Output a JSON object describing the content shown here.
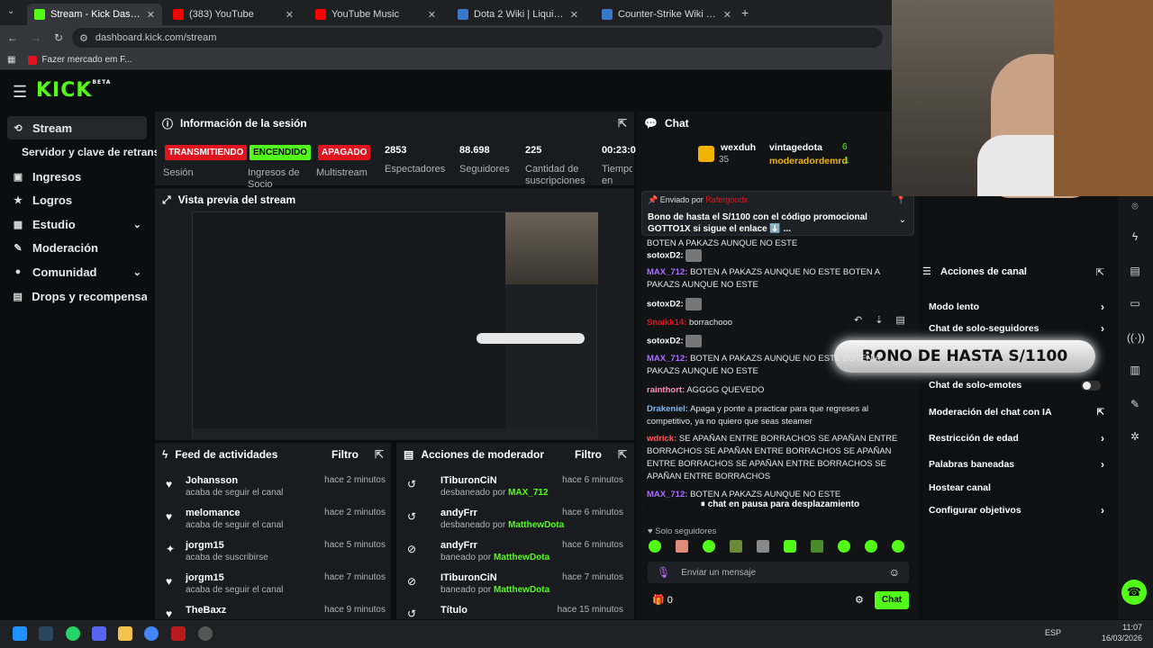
{
  "tabs": [
    {
      "title": "Stream - Kick Dashboard",
      "active": true,
      "color": "#53fc18"
    },
    {
      "title": "(383) YouTube",
      "active": false,
      "color": "#ff0000"
    },
    {
      "title": "YouTube Music",
      "active": false,
      "color": "#ff0000"
    },
    {
      "title": "Dota 2 Wiki | Liquipedia",
      "active": false,
      "color": "#3c76c8"
    },
    {
      "title": "Counter-Strike Wiki | CS2 | Liqu",
      "active": false,
      "color": "#3c76c8"
    }
  ],
  "address": "dashboard.kick.com/stream",
  "bookmark": "Fazer mercado em F...",
  "logo": "KICK",
  "logo_sup": "BETA",
  "sidebar": [
    {
      "label": "Stream",
      "icon": "link-icon",
      "glyph": "⟲"
    },
    {
      "label": "Servidor y clave de retransm",
      "icon": "",
      "glyph": ""
    },
    {
      "label": "Ingresos",
      "icon": "wallet-icon",
      "glyph": "▣"
    },
    {
      "label": "Logros",
      "icon": "trophy-icon",
      "glyph": "★"
    },
    {
      "label": "Estudio",
      "icon": "grid-icon",
      "glyph": "▦"
    },
    {
      "label": "Moderación",
      "icon": "wrench-icon",
      "glyph": "✎"
    },
    {
      "label": "Comunidad",
      "icon": "people-icon",
      "glyph": "●"
    },
    {
      "label": "Drops y recompensas",
      "icon": "gift-icon",
      "glyph": "▤"
    }
  ],
  "session": {
    "title": "Información de la sesión",
    "badges": [
      {
        "label": "TRANSMITIENDO",
        "bg": "#e0141e",
        "fg": "#ffffff"
      },
      {
        "label": "ENCENDIDO",
        "bg": "#53fc18",
        "fg": "#000000"
      },
      {
        "label": "APAGADO",
        "bg": "#e0141e",
        "fg": "#ffffff"
      }
    ],
    "badge_labels": [
      "Sesión",
      "Ingresos de Socio",
      "Multistream"
    ],
    "stats": [
      {
        "value": "2853",
        "label": "Espectadores"
      },
      {
        "value": "88.698",
        "label": "Seguidores"
      },
      {
        "value": "225",
        "label": "Cantidad de suscripciones"
      },
      {
        "value": "00:23:0",
        "label": "Tiempo en vivo"
      }
    ]
  },
  "preview_title": "Vista previa del stream",
  "feed": {
    "title": "Feed de actividades",
    "filter": "Filtro",
    "items": [
      {
        "name": "Johansson",
        "action": "acaba de seguir el canal",
        "time": "hace 2 minutos",
        "icon": "heart-icon",
        "glyph": "♥"
      },
      {
        "name": "melomance",
        "action": "acaba de seguir el canal",
        "time": "hace 2 minutos",
        "icon": "heart-icon",
        "glyph": "♥"
      },
      {
        "name": "jorgm15",
        "action": "acaba de suscribirse",
        "time": "hace 5 minutos",
        "icon": "star-icon",
        "glyph": "✦"
      },
      {
        "name": "jorgm15",
        "action": "acaba de seguir el canal",
        "time": "hace 7 minutos",
        "icon": "heart-icon",
        "glyph": "♥"
      },
      {
        "name": "TheBaxz",
        "action": "",
        "time": "hace 9 minutos",
        "icon": "heart-icon",
        "glyph": "♥"
      }
    ]
  },
  "modactions": {
    "title": "Acciones de moderador",
    "filter": "Filtro",
    "items": [
      {
        "name": "ITiburonCiN",
        "action": "desbaneado por",
        "by": "MAX_712",
        "time": "hace 6 minutos",
        "icon": "undo-icon",
        "glyph": "↺"
      },
      {
        "name": "andyFrr",
        "action": "desbaneado por",
        "by": "MatthewDota",
        "time": "hace 6 minutos",
        "icon": "undo-icon",
        "glyph": "↺"
      },
      {
        "name": "andyFrr",
        "action": "baneado por",
        "by": "MatthewDota",
        "time": "hace 6 minutos",
        "icon": "ban-icon",
        "glyph": "⊘"
      },
      {
        "name": "ITiburonCiN",
        "action": "baneado por",
        "by": "MatthewDota",
        "time": "hace 7 minutos",
        "icon": "ban-icon",
        "glyph": "⊘"
      },
      {
        "name": "Título",
        "action": "",
        "by": "",
        "time": "hace 15 minutos",
        "icon": "undo-icon",
        "glyph": "↺"
      }
    ]
  },
  "chat": {
    "title": "Chat",
    "top_users": [
      {
        "name": "wexduh",
        "count": "35"
      },
      {
        "name": "vintagedota",
        "count": "6"
      },
      {
        "name": "moderadordemrd",
        "count": "1"
      }
    ],
    "pinned_by_label": "Enviado por",
    "pinned_by": "Rafergoodx",
    "pinned": "Bono de hasta el S/1100 con el código promocional GOTTO1X si sigue el enlace ⬇️ ...",
    "messages": [
      {
        "user": "",
        "color": "#ffffff",
        "text": "BOTEN A PAKAZS AUNQUE NO ESTE"
      },
      {
        "user": "sotoxD2:",
        "color": "#ffffff",
        "text": ""
      },
      {
        "user": "MAX_712:",
        "color": "#a970ff",
        "text": "BOTEN A PAKAZS AUNQUE NO ESTE BOTEN A PAKAZS AUNQUE NO ESTE"
      },
      {
        "user": "sotoxD2:",
        "color": "#ffffff",
        "text": ""
      },
      {
        "user": "Snaikk14:",
        "color": "#e0141e",
        "text": "borrachooo"
      },
      {
        "user": "sotoxD2:",
        "color": "#ffffff",
        "text": ""
      },
      {
        "user": "MAX_712:",
        "color": "#a970ff",
        "text": "BOTEN A PAKAZS AUNQUE NO ESTE BOTEN A PAKAZS AUNQUE NO ESTE"
      },
      {
        "user": "rainthort:",
        "color": "#ff8fb8",
        "text": "AGGGG QUEVEDO"
      },
      {
        "user": "Drakeniel:",
        "color": "#7cb9ff",
        "text": "Apaga y ponte a practicar para que regreses al competitivo, ya no quiero que seas steamer"
      },
      {
        "user": "wdrick:",
        "color": "#ff5a5a",
        "text": "SE APAÑAN ENTRE BORRACHOS SE APAÑAN ENTRE BORRACHOS SE APAÑAN ENTRE BORRACHOS SE APAÑAN ENTRE BORRACHOS SE APAÑAN ENTRE BORRACHOS SE APAÑAN ENTRE BORRACHOS"
      },
      {
        "user": "MAX_712:",
        "color": "#a970ff",
        "text": "BOTEN A PAKAZS AUNQUE NO ESTE"
      }
    ],
    "paused": "chat en pausa para desplazamiento",
    "followers_only": "Solo seguidores",
    "input_placeholder": "Enviar un mensaje",
    "points": "0",
    "send": "Chat"
  },
  "channel_actions": {
    "title": "Acciones de canal",
    "items": [
      {
        "label": "Modo lento",
        "kind": "chevron"
      },
      {
        "label": "Chat de solo-seguidores",
        "kind": "chevron"
      },
      {
        "label": "",
        "kind": "none"
      },
      {
        "label": "Chat de solo-emotes",
        "kind": "toggle"
      },
      {
        "label": "Moderación del chat con IA",
        "kind": "external"
      },
      {
        "label": "Restricción de edad",
        "kind": "chevron"
      },
      {
        "label": "Palabras baneadas",
        "kind": "chevron"
      },
      {
        "label": "Hostear canal",
        "kind": "none"
      },
      {
        "label": "Configurar objetivos",
        "kind": "chevron"
      }
    ]
  },
  "promo": "BONO DE HASTA S/1100",
  "taskbar": {
    "lang": "ESP",
    "time": "11:07",
    "date": "16/03/2026"
  },
  "colors": {
    "accent": "#53fc18",
    "panel": "#191b1f",
    "bg": "#0b0e0f"
  }
}
